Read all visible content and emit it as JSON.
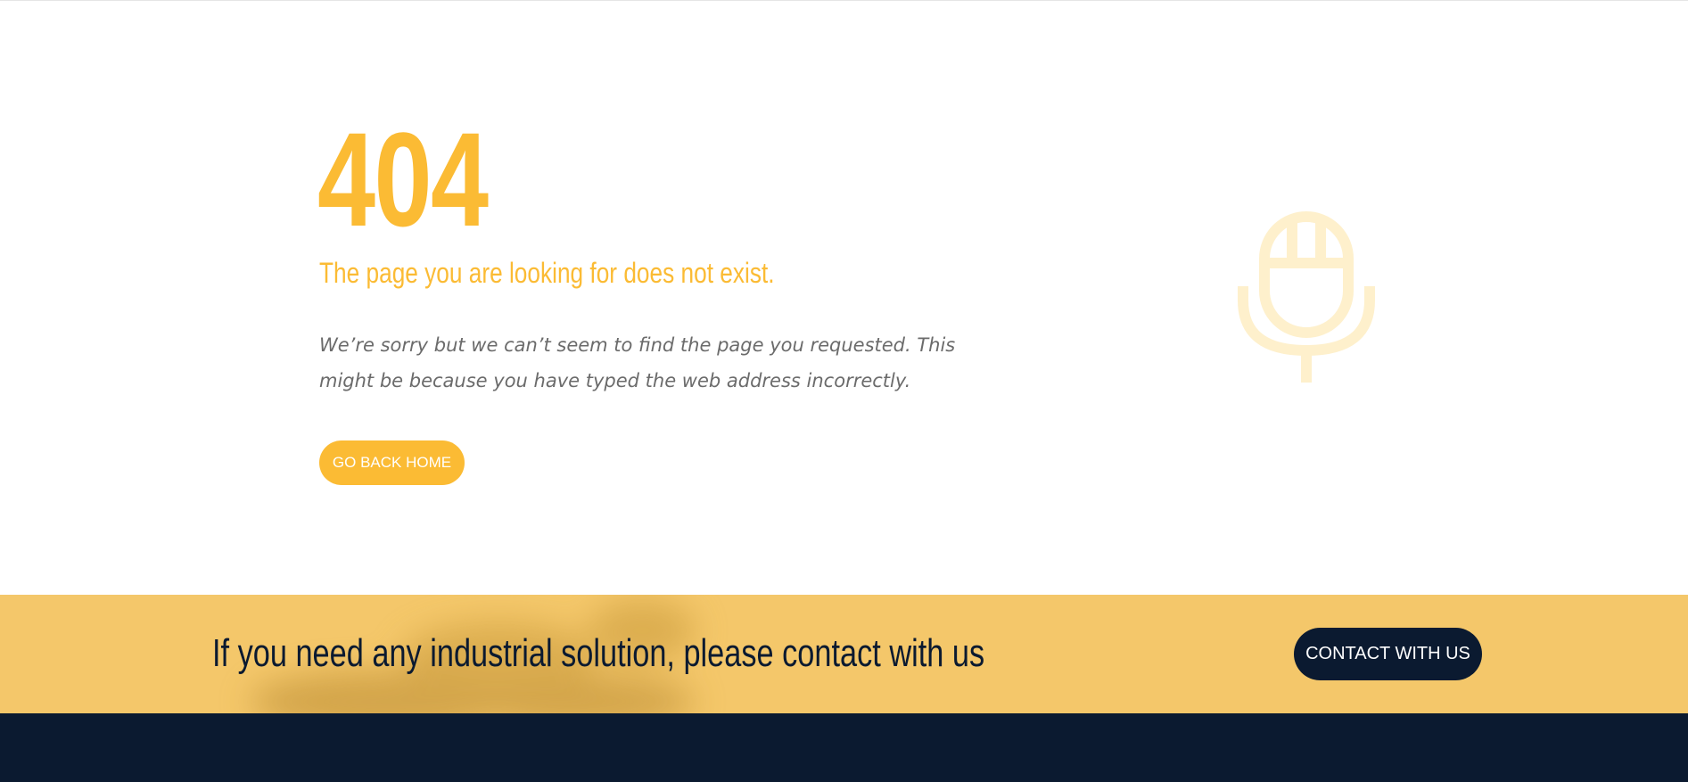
{
  "error": {
    "code": "404",
    "heading": "The page you are looking for does not exist.",
    "message": "We’re sorry but we can’t seem to find the page you requested. This might be because you have typed the web address incorrectly.",
    "button_label": "GO BACK HOME",
    "illustration_icon": "microphone-icon"
  },
  "cta": {
    "text": "If you need any industrial solution, please contact with us",
    "button_label": "CONTACT WITH US"
  },
  "colors": {
    "accent": "#fbbb34",
    "dark": "#0b1a30",
    "cta_background": "#f4c76a",
    "muted_text": "#6b6b6b",
    "icon_faded": "#fef0cc"
  }
}
